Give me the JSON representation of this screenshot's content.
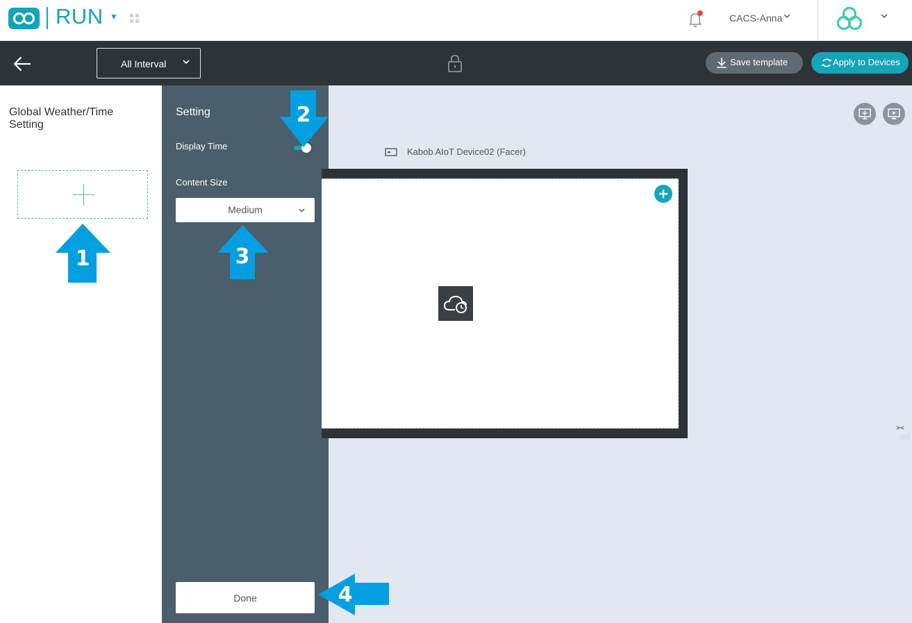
{
  "header": {
    "app_name": "RUN",
    "user_name": "CACS-Anna",
    "accent_color": "#14a3b8"
  },
  "toolbar": {
    "interval_select": "All Interval",
    "save_template_label": "Save template",
    "apply_devices_label": "Apply to Devices"
  },
  "left_panel": {
    "title": "Global Weather/Time Setting"
  },
  "setting_panel": {
    "title": "Setting",
    "display_time_label": "Display Time",
    "display_time_on": true,
    "content_size_label": "Content Size",
    "content_size_value": "Medium",
    "done_label": "Done"
  },
  "canvas": {
    "device_name": "Kabob AIoT Device02 (Facer)",
    "widget_icon": "weather-time-icon"
  },
  "annotations": {
    "color": "#039fe0",
    "steps": [
      "1",
      "2",
      "3",
      "4"
    ]
  }
}
